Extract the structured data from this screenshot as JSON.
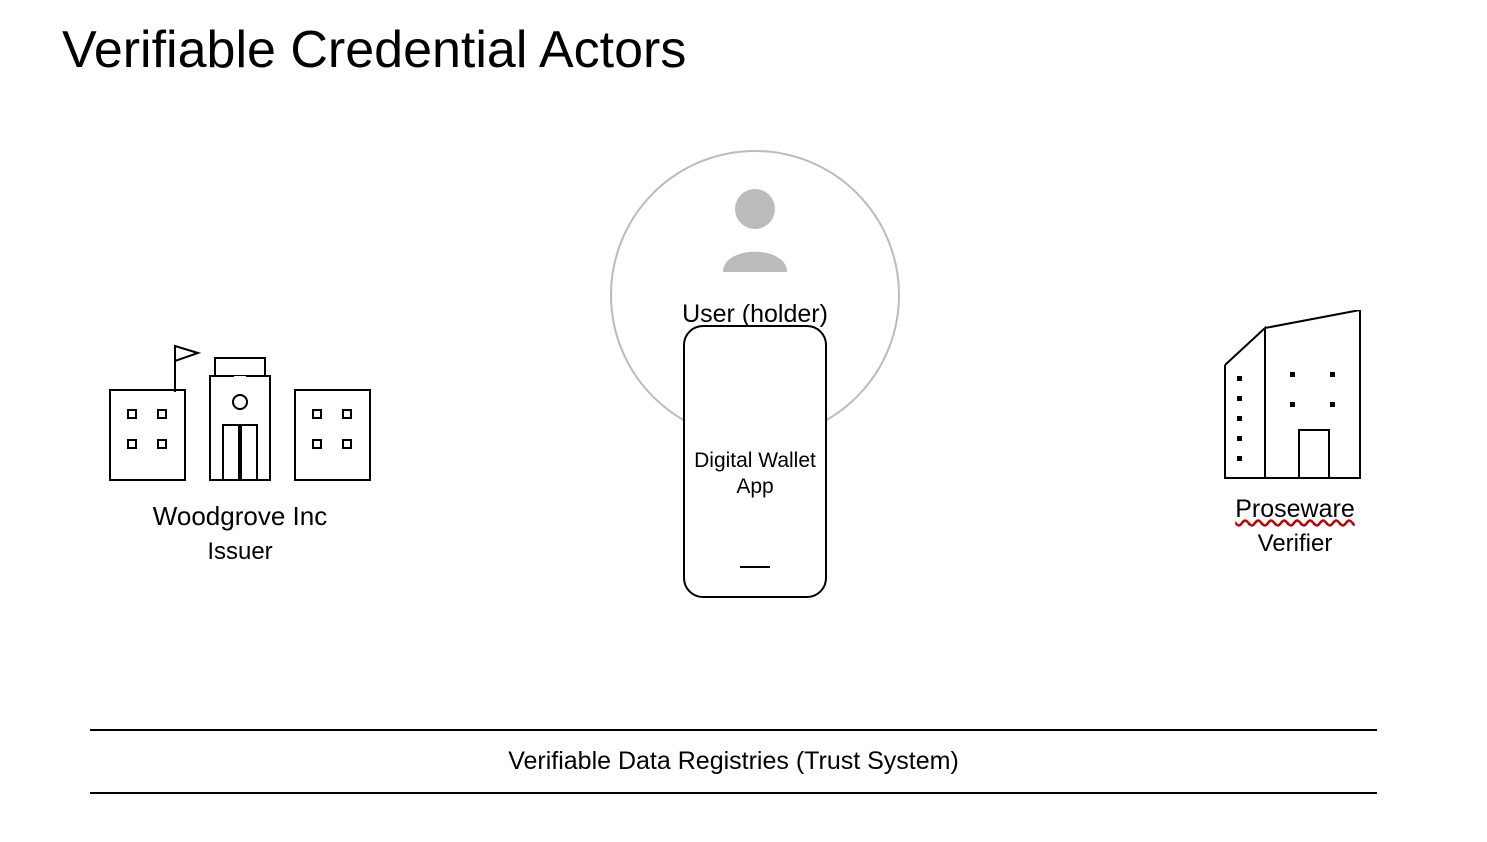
{
  "title": "Verifiable Credential Actors",
  "issuer": {
    "name": "Woodgrove Inc",
    "role": "Issuer"
  },
  "holder": {
    "label": "User (holder)",
    "wallet_line1": "Digital Wallet",
    "wallet_line2": "App"
  },
  "verifier": {
    "name": "Proseware",
    "role": "Verifier"
  },
  "registry": {
    "label": "Verifiable Data Registries (Trust System)"
  }
}
